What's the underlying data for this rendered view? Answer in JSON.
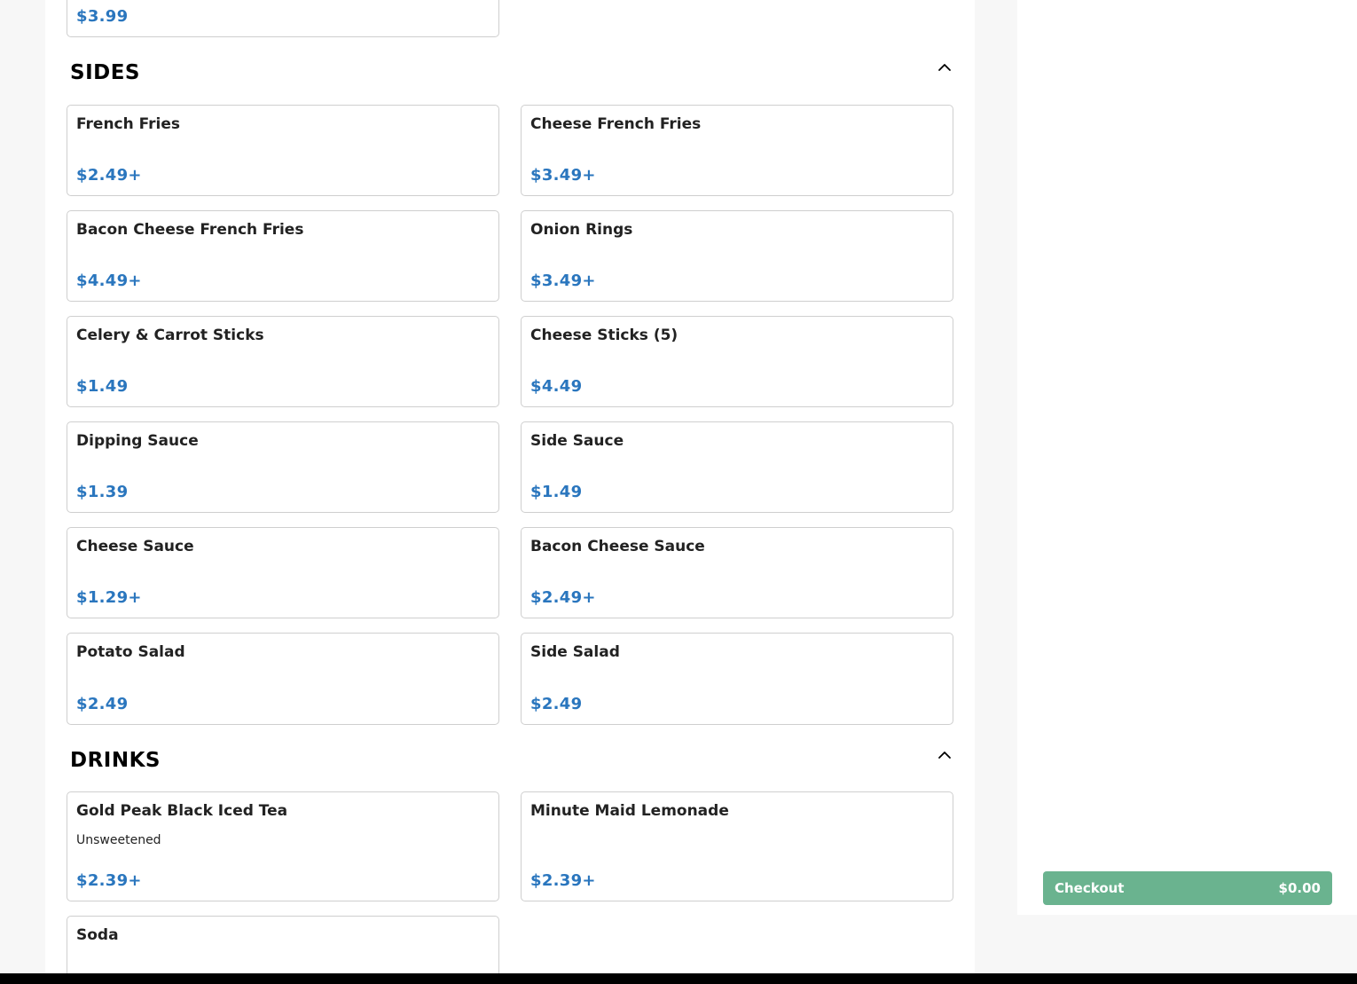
{
  "top_card": {
    "price": "$3.99"
  },
  "sides": {
    "title": "SIDES",
    "items": [
      {
        "name": "French Fries",
        "price": "$2.49+"
      },
      {
        "name": "Cheese French Fries",
        "price": "$3.49+"
      },
      {
        "name": "Bacon Cheese French Fries",
        "price": "$4.49+"
      },
      {
        "name": "Onion Rings",
        "price": "$3.49+"
      },
      {
        "name": "Celery & Carrot Sticks",
        "price": "$1.49"
      },
      {
        "name": "Cheese Sticks (5)",
        "price": "$4.49"
      },
      {
        "name": "Dipping Sauce",
        "price": "$1.39"
      },
      {
        "name": "Side Sauce",
        "price": "$1.49"
      },
      {
        "name": "Cheese Sauce",
        "price": "$1.29+"
      },
      {
        "name": "Bacon Cheese Sauce",
        "price": "$2.49+"
      },
      {
        "name": "Potato Salad",
        "price": "$2.49"
      },
      {
        "name": "Side Salad",
        "price": "$2.49"
      }
    ]
  },
  "drinks": {
    "title": "DRINKS",
    "items": [
      {
        "name": "Gold Peak Black Iced Tea",
        "description": "Unsweetened",
        "price": "$2.39+"
      },
      {
        "name": "Minute Maid Lemonade",
        "price": "$2.39+"
      },
      {
        "name": "Soda"
      }
    ]
  },
  "cart": {
    "checkout_label": "Checkout",
    "total": "$0.00"
  },
  "colors": {
    "price": "#2a76be",
    "checkout_bg": "#6ab38f"
  },
  "icons": {
    "collapse": "chevron-up-icon"
  }
}
